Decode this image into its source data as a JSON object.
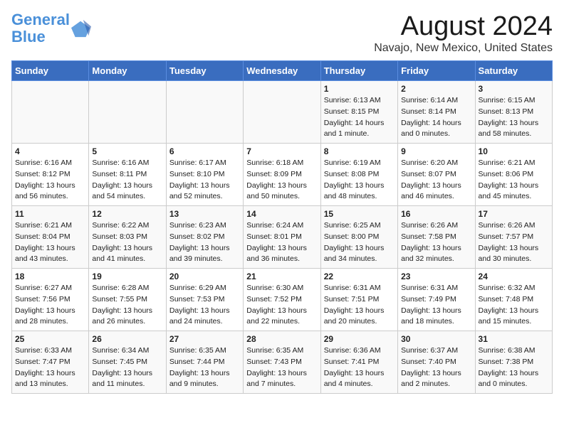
{
  "header": {
    "logo_line1": "General",
    "logo_line2": "Blue",
    "main_title": "August 2024",
    "subtitle": "Navajo, New Mexico, United States"
  },
  "days_of_week": [
    "Sunday",
    "Monday",
    "Tuesday",
    "Wednesday",
    "Thursday",
    "Friday",
    "Saturday"
  ],
  "weeks": [
    [
      {
        "day": "",
        "info": ""
      },
      {
        "day": "",
        "info": ""
      },
      {
        "day": "",
        "info": ""
      },
      {
        "day": "",
        "info": ""
      },
      {
        "day": "1",
        "info": "Sunrise: 6:13 AM\nSunset: 8:15 PM\nDaylight: 14 hours\nand 1 minute."
      },
      {
        "day": "2",
        "info": "Sunrise: 6:14 AM\nSunset: 8:14 PM\nDaylight: 14 hours\nand 0 minutes."
      },
      {
        "day": "3",
        "info": "Sunrise: 6:15 AM\nSunset: 8:13 PM\nDaylight: 13 hours\nand 58 minutes."
      }
    ],
    [
      {
        "day": "4",
        "info": "Sunrise: 6:16 AM\nSunset: 8:12 PM\nDaylight: 13 hours\nand 56 minutes."
      },
      {
        "day": "5",
        "info": "Sunrise: 6:16 AM\nSunset: 8:11 PM\nDaylight: 13 hours\nand 54 minutes."
      },
      {
        "day": "6",
        "info": "Sunrise: 6:17 AM\nSunset: 8:10 PM\nDaylight: 13 hours\nand 52 minutes."
      },
      {
        "day": "7",
        "info": "Sunrise: 6:18 AM\nSunset: 8:09 PM\nDaylight: 13 hours\nand 50 minutes."
      },
      {
        "day": "8",
        "info": "Sunrise: 6:19 AM\nSunset: 8:08 PM\nDaylight: 13 hours\nand 48 minutes."
      },
      {
        "day": "9",
        "info": "Sunrise: 6:20 AM\nSunset: 8:07 PM\nDaylight: 13 hours\nand 46 minutes."
      },
      {
        "day": "10",
        "info": "Sunrise: 6:21 AM\nSunset: 8:06 PM\nDaylight: 13 hours\nand 45 minutes."
      }
    ],
    [
      {
        "day": "11",
        "info": "Sunrise: 6:21 AM\nSunset: 8:04 PM\nDaylight: 13 hours\nand 43 minutes."
      },
      {
        "day": "12",
        "info": "Sunrise: 6:22 AM\nSunset: 8:03 PM\nDaylight: 13 hours\nand 41 minutes."
      },
      {
        "day": "13",
        "info": "Sunrise: 6:23 AM\nSunset: 8:02 PM\nDaylight: 13 hours\nand 39 minutes."
      },
      {
        "day": "14",
        "info": "Sunrise: 6:24 AM\nSunset: 8:01 PM\nDaylight: 13 hours\nand 36 minutes."
      },
      {
        "day": "15",
        "info": "Sunrise: 6:25 AM\nSunset: 8:00 PM\nDaylight: 13 hours\nand 34 minutes."
      },
      {
        "day": "16",
        "info": "Sunrise: 6:26 AM\nSunset: 7:58 PM\nDaylight: 13 hours\nand 32 minutes."
      },
      {
        "day": "17",
        "info": "Sunrise: 6:26 AM\nSunset: 7:57 PM\nDaylight: 13 hours\nand 30 minutes."
      }
    ],
    [
      {
        "day": "18",
        "info": "Sunrise: 6:27 AM\nSunset: 7:56 PM\nDaylight: 13 hours\nand 28 minutes."
      },
      {
        "day": "19",
        "info": "Sunrise: 6:28 AM\nSunset: 7:55 PM\nDaylight: 13 hours\nand 26 minutes."
      },
      {
        "day": "20",
        "info": "Sunrise: 6:29 AM\nSunset: 7:53 PM\nDaylight: 13 hours\nand 24 minutes."
      },
      {
        "day": "21",
        "info": "Sunrise: 6:30 AM\nSunset: 7:52 PM\nDaylight: 13 hours\nand 22 minutes."
      },
      {
        "day": "22",
        "info": "Sunrise: 6:31 AM\nSunset: 7:51 PM\nDaylight: 13 hours\nand 20 minutes."
      },
      {
        "day": "23",
        "info": "Sunrise: 6:31 AM\nSunset: 7:49 PM\nDaylight: 13 hours\nand 18 minutes."
      },
      {
        "day": "24",
        "info": "Sunrise: 6:32 AM\nSunset: 7:48 PM\nDaylight: 13 hours\nand 15 minutes."
      }
    ],
    [
      {
        "day": "25",
        "info": "Sunrise: 6:33 AM\nSunset: 7:47 PM\nDaylight: 13 hours\nand 13 minutes."
      },
      {
        "day": "26",
        "info": "Sunrise: 6:34 AM\nSunset: 7:45 PM\nDaylight: 13 hours\nand 11 minutes."
      },
      {
        "day": "27",
        "info": "Sunrise: 6:35 AM\nSunset: 7:44 PM\nDaylight: 13 hours\nand 9 minutes."
      },
      {
        "day": "28",
        "info": "Sunrise: 6:35 AM\nSunset: 7:43 PM\nDaylight: 13 hours\nand 7 minutes."
      },
      {
        "day": "29",
        "info": "Sunrise: 6:36 AM\nSunset: 7:41 PM\nDaylight: 13 hours\nand 4 minutes."
      },
      {
        "day": "30",
        "info": "Sunrise: 6:37 AM\nSunset: 7:40 PM\nDaylight: 13 hours\nand 2 minutes."
      },
      {
        "day": "31",
        "info": "Sunrise: 6:38 AM\nSunset: 7:38 PM\nDaylight: 13 hours\nand 0 minutes."
      }
    ]
  ]
}
